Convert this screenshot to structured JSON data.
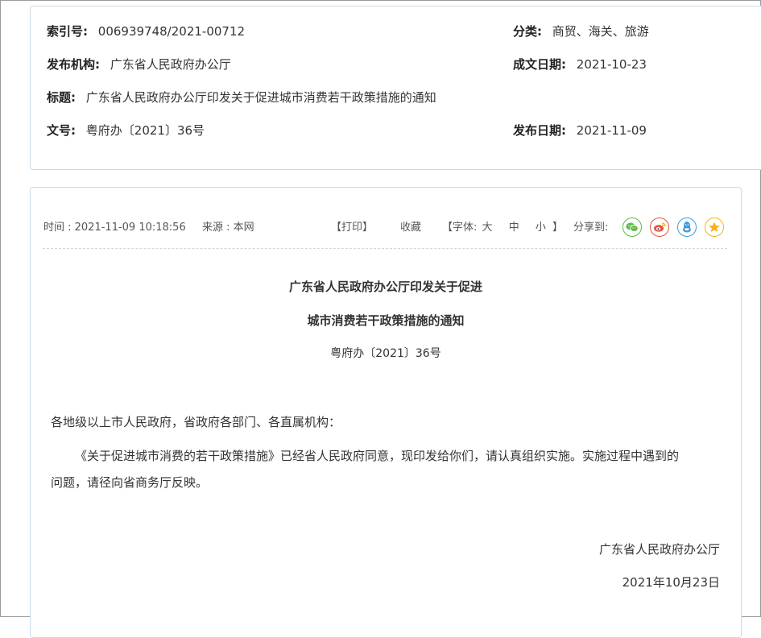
{
  "info": {
    "index_label": "索引号:",
    "index_value": "006939748/2021-00712",
    "category_label": "分类:",
    "category_value": "商贸、海关、旅游",
    "issuer_label": "发布机构:",
    "issuer_value": "广东省人民政府办公厅",
    "created_label": "成文日期:",
    "created_value": "2021-10-23",
    "title_label": "标题:",
    "title_value": "广东省人民政府办公厅印发关于促进城市消费若干政策措施的通知",
    "docno_label": "文号:",
    "docno_value": "粤府办〔2021〕36号",
    "published_label": "发布日期:",
    "published_value": "2021-11-09"
  },
  "meta": {
    "time": "时间 : 2021-11-09 10:18:56",
    "source": "来源 : 本网",
    "print": "【打印】",
    "favorite": "收藏",
    "font_open": "【字体:",
    "font_large": "大",
    "font_medium": "中",
    "font_small": "小",
    "font_close": "】",
    "share_label": "分享到:"
  },
  "share_icons": {
    "wechat": "wechat-icon",
    "weibo": "weibo-icon",
    "qq": "qq-icon",
    "qzone": "qzone-star-icon",
    "colors": {
      "green": "#5fb94a",
      "red": "#e8533c",
      "blue": "#3b9de0",
      "yellow": "#f2b21c"
    }
  },
  "article": {
    "title_line1": "广东省人民政府办公厅印发关于促进",
    "title_line2": "城市消费若干政策措施的通知",
    "doc_number": "粤府办〔2021〕36号",
    "salutation": "各地级以上市人民政府，省政府各部门、各直属机构：",
    "para1_line1": "《关于促进城市消费的若干政策措施》已经省人民政府同意，现印发给你们，请认真组织实施。实施过程中遇到的",
    "para1_line2": "问题，请径向省商务厅反映。",
    "signature": "广东省人民政府办公厅",
    "date": "2021年10月23日"
  }
}
